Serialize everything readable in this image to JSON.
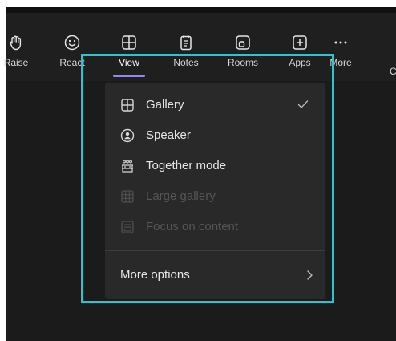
{
  "toolbar": {
    "items": [
      {
        "label": "Raise",
        "icon": "raise-hand-icon"
      },
      {
        "label": "React",
        "icon": "smiley-icon"
      },
      {
        "label": "View",
        "icon": "grid-icon",
        "active": true
      },
      {
        "label": "Notes",
        "icon": "notes-icon"
      },
      {
        "label": "Rooms",
        "icon": "rooms-icon"
      },
      {
        "label": "Apps",
        "icon": "plus-square-icon"
      },
      {
        "label": "More",
        "icon": "ellipsis-icon"
      }
    ],
    "cutoff_label": "C"
  },
  "menu": {
    "items": [
      {
        "label": "Gallery",
        "icon": "gallery-icon",
        "checked": true,
        "enabled": true
      },
      {
        "label": "Speaker",
        "icon": "speaker-icon",
        "checked": false,
        "enabled": true
      },
      {
        "label": "Together mode",
        "icon": "together-mode-icon",
        "checked": false,
        "enabled": true
      },
      {
        "label": "Large gallery",
        "icon": "large-gallery-icon",
        "checked": false,
        "enabled": false
      },
      {
        "label": "Focus on content",
        "icon": "focus-content-icon",
        "checked": false,
        "enabled": false
      }
    ],
    "more_options": {
      "label": "More options",
      "icon": "chevron-right-icon"
    }
  },
  "colors": {
    "accent": "#8b8cf0",
    "highlight": "#2ec4cf",
    "menu_bg": "#292929",
    "toolbar_bg": "#1f1f1f"
  }
}
